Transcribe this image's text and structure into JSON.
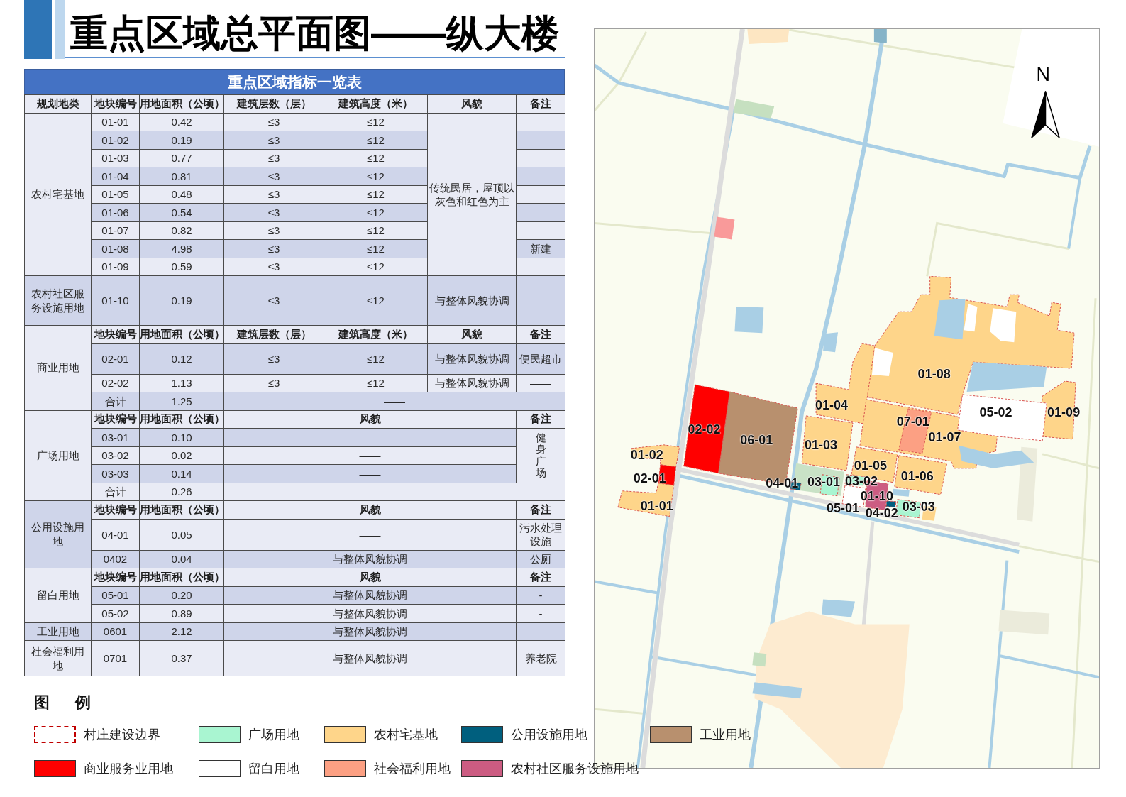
{
  "title": "重点区域总平面图——纵大楼",
  "table": {
    "caption": "重点区域指标一览表",
    "columns": [
      "规划地类",
      "地块编号",
      "用地面积（公顷）",
      "建筑层数（层）",
      "建筑高度（米）",
      "风貌",
      "备注"
    ],
    "groups": [
      {
        "category": "农村宅基地",
        "kind": "full",
        "shared_appearance": "传统民居，屋顶以灰色和红色为主",
        "rows": [
          {
            "plot": "01-01",
            "area": "0.42",
            "floors": "≤3",
            "height": "≤12"
          },
          {
            "plot": "01-02",
            "area": "0.19",
            "floors": "≤3",
            "height": "≤12"
          },
          {
            "plot": "01-03",
            "area": "0.77",
            "floors": "≤3",
            "height": "≤12"
          },
          {
            "plot": "01-04",
            "area": "0.81",
            "floors": "≤3",
            "height": "≤12"
          },
          {
            "plot": "01-05",
            "area": "0.48",
            "floors": "≤3",
            "height": "≤12"
          },
          {
            "plot": "01-06",
            "area": "0.54",
            "floors": "≤3",
            "height": "≤12"
          },
          {
            "plot": "01-07",
            "area": "0.82",
            "floors": "≤3",
            "height": "≤12"
          },
          {
            "plot": "01-08",
            "area": "4.98",
            "floors": "≤3",
            "height": "≤12",
            "note": "新建"
          },
          {
            "plot": "01-09",
            "area": "0.59",
            "floors": "≤3",
            "height": "≤12"
          }
        ]
      },
      {
        "category": "农村社区服务设施用地",
        "kind": "full",
        "rows": [
          {
            "plot": "01-10",
            "area": "0.19",
            "floors": "≤3",
            "height": "≤12",
            "appearance": "与整体风貌协调"
          }
        ]
      },
      {
        "category": "商业用地",
        "kind": "full",
        "header": [
          "地块编号",
          "用地面积（公顷）",
          "建筑层数（层）",
          "建筑高度（米）",
          "风貌",
          "备注"
        ],
        "rows": [
          {
            "plot": "02-01",
            "area": "0.12",
            "floors": "≤3",
            "height": "≤12",
            "appearance": "与整体风貌协调",
            "note": "便民超市"
          },
          {
            "plot": "02-02",
            "area": "1.13",
            "floors": "≤3",
            "height": "≤12",
            "appearance": "与整体风貌协调",
            "note": "——"
          }
        ],
        "total": {
          "label": "合计",
          "area": "1.25",
          "rest": "——"
        }
      },
      {
        "category": "广场用地",
        "kind": "short",
        "header": [
          "地块编号",
          "用地面积（公顷）",
          "风貌",
          "备注"
        ],
        "shared_note": "健身广场",
        "rows": [
          {
            "plot": "03-01",
            "area": "0.10",
            "appearance": "——"
          },
          {
            "plot": "03-02",
            "area": "0.02",
            "appearance": "——"
          },
          {
            "plot": "03-03",
            "area": "0.14",
            "appearance": "——"
          }
        ],
        "total": {
          "label": "合计",
          "area": "0.26",
          "rest": "——"
        }
      },
      {
        "category": "公用设施用地",
        "kind": "short",
        "header": [
          "地块编号",
          "用地面积（公顷）",
          "风貌",
          "备注"
        ],
        "rows": [
          {
            "plot": "04-01",
            "area": "0.05",
            "appearance": "——",
            "note": "污水处理设施"
          },
          {
            "plot": "0402",
            "area": "0.04",
            "appearance": "与整体风貌协调",
            "note": "公厕"
          }
        ]
      },
      {
        "category": "留白用地",
        "kind": "short",
        "header": [
          "地块编号",
          "用地面积（公顷）",
          "风貌",
          "备注"
        ],
        "rows": [
          {
            "plot": "05-01",
            "area": "0.20",
            "appearance": "与整体风貌协调",
            "note": "-"
          },
          {
            "plot": "05-02",
            "area": "0.89",
            "appearance": "与整体风貌协调",
            "note": "-"
          }
        ]
      },
      {
        "category": "工业用地",
        "kind": "short",
        "rows": [
          {
            "plot": "0601",
            "area": "2.12",
            "appearance": "与整体风貌协调"
          }
        ]
      },
      {
        "category": "社会福利用地",
        "kind": "short",
        "rows": [
          {
            "plot": "0701",
            "area": "0.37",
            "appearance": "与整体风貌协调",
            "note": "养老院"
          }
        ]
      }
    ]
  },
  "legend": {
    "title": "图 例",
    "items": [
      {
        "label": "村庄建设边界",
        "kind": "boundary",
        "color": "#c00000"
      },
      {
        "label": "广场用地",
        "kind": "fill",
        "color": "#a9f5d1"
      },
      {
        "label": "农村宅基地",
        "kind": "fill",
        "color": "#fed58a"
      },
      {
        "label": "公用设施用地",
        "kind": "fill",
        "color": "#005f7e"
      },
      {
        "label": "工业用地",
        "kind": "fill",
        "color": "#b8906e"
      },
      {
        "label": "商业服务业用地",
        "kind": "fill",
        "color": "#ff0000"
      },
      {
        "label": "留白用地",
        "kind": "fill",
        "color": "#ffffff"
      },
      {
        "label": "社会福利用地",
        "kind": "fill",
        "color": "#fca083"
      },
      {
        "label": "农村社区服务设施用地",
        "kind": "fill",
        "color": "#cc5c82"
      }
    ]
  },
  "map": {
    "north_label": "N",
    "parcels": [
      {
        "label": "01-08",
        "color": "#fed58a"
      },
      {
        "label": "01-04",
        "color": "#fed58a"
      },
      {
        "label": "05-02",
        "color": "#ffffff"
      },
      {
        "label": "01-09",
        "color": "#fed58a"
      },
      {
        "label": "07-01",
        "color": "#fca083"
      },
      {
        "label": "02-02",
        "color": "#ff0000"
      },
      {
        "label": "06-01",
        "color": "#b8906e"
      },
      {
        "label": "01-03",
        "color": "#fed58a"
      },
      {
        "label": "01-07",
        "color": "#fed58a"
      },
      {
        "label": "01-02",
        "color": "#fed58a"
      },
      {
        "label": "01-05",
        "color": "#fed58a"
      },
      {
        "label": "02-01",
        "color": "#ff0000"
      },
      {
        "label": "04-01",
        "color": "#005f7e"
      },
      {
        "label": "03-01",
        "color": "#a9f5d1"
      },
      {
        "label": "03-02",
        "color": "#a9f5d1"
      },
      {
        "label": "01-06",
        "color": "#fed58a"
      },
      {
        "label": "01-10",
        "color": "#cc5c82"
      },
      {
        "label": "01-01",
        "color": "#fed58a"
      },
      {
        "label": "05-01",
        "color": "#ffffff"
      },
      {
        "label": "04-02",
        "color": "#005f7e"
      },
      {
        "label": "03-03",
        "color": "#a9f5d1"
      }
    ]
  }
}
